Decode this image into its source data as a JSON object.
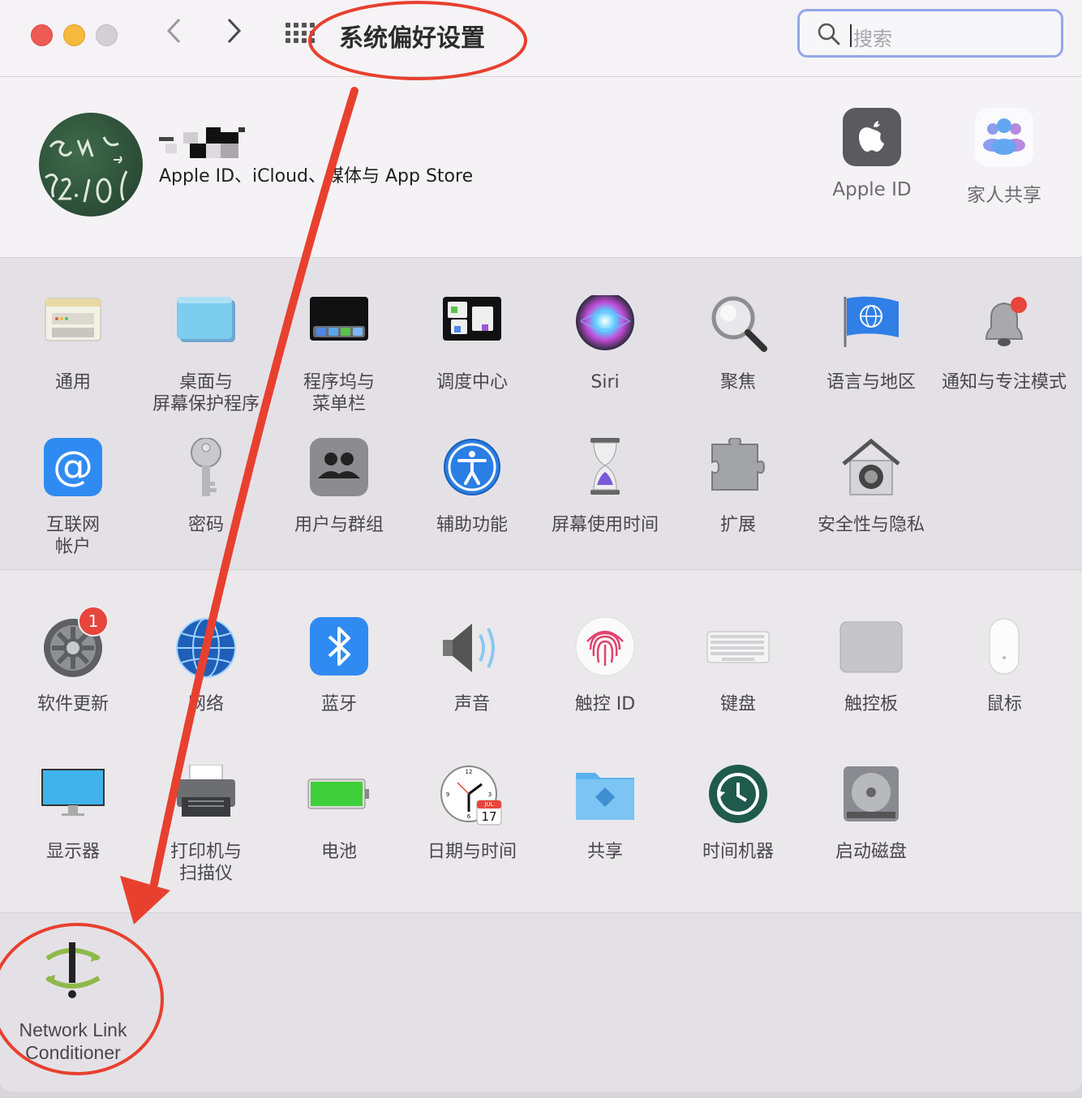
{
  "window": {
    "title": "系统偏好设置",
    "nav_back": "‹",
    "nav_forward": "›",
    "search_placeholder": "搜索"
  },
  "account": {
    "subtitle": "Apple ID、iCloud、媒体与 App Store",
    "shortcuts": [
      {
        "label": "Apple ID",
        "icon": "apple-logo-icon"
      },
      {
        "label": "家人共享",
        "icon": "family-sharing-icon"
      }
    ]
  },
  "section1": [
    {
      "label": "通用",
      "icon": "general-icon"
    },
    {
      "label": "桌面与\n屏幕保护程序",
      "icon": "desktop-icon"
    },
    {
      "label": "程序坞与\n菜单栏",
      "icon": "dock-icon"
    },
    {
      "label": "调度中心",
      "icon": "mission-control-icon"
    },
    {
      "label": "Siri",
      "icon": "siri-icon"
    },
    {
      "label": "聚焦",
      "icon": "spotlight-icon"
    },
    {
      "label": "语言与地区",
      "icon": "language-flag-icon"
    },
    {
      "label": "通知与专注模式",
      "icon": "notification-bell-icon"
    },
    {
      "label": "互联网\n帐户",
      "icon": "internet-accounts-icon"
    },
    {
      "label": "密码",
      "icon": "key-icon"
    },
    {
      "label": "用户与群组",
      "icon": "users-icon"
    },
    {
      "label": "辅助功能",
      "icon": "accessibility-icon"
    },
    {
      "label": "屏幕使用时间",
      "icon": "hourglass-icon"
    },
    {
      "label": "扩展",
      "icon": "puzzle-icon"
    },
    {
      "label": "安全性与隐私",
      "icon": "house-lock-icon"
    }
  ],
  "section2": [
    {
      "label": "软件更新",
      "icon": "gear-icon",
      "badge": "1"
    },
    {
      "label": "网络",
      "icon": "globe-icon"
    },
    {
      "label": "蓝牙",
      "icon": "bluetooth-icon"
    },
    {
      "label": "声音",
      "icon": "speaker-icon"
    },
    {
      "label": "触控 ID",
      "icon": "fingerprint-icon"
    },
    {
      "label": "键盘",
      "icon": "keyboard-icon"
    },
    {
      "label": "触控板",
      "icon": "trackpad-icon"
    },
    {
      "label": "鼠标",
      "icon": "mouse-icon"
    },
    {
      "label": "显示器",
      "icon": "display-icon"
    },
    {
      "label": "打印机与\n扫描仪",
      "icon": "printer-icon"
    },
    {
      "label": "电池",
      "icon": "battery-icon"
    },
    {
      "label": "日期与时间",
      "icon": "clock-icon",
      "date_badge": "17",
      "month_badge": "JUL"
    },
    {
      "label": "共享",
      "icon": "sharing-folder-icon"
    },
    {
      "label": "时间机器",
      "icon": "time-machine-icon"
    },
    {
      "label": "启动磁盘",
      "icon": "disk-icon"
    }
  ],
  "section3": [
    {
      "label": "Network Link\nConditioner",
      "icon": "network-link-conditioner-icon"
    }
  ],
  "colors": {
    "annotation_red": "#e8402f"
  }
}
